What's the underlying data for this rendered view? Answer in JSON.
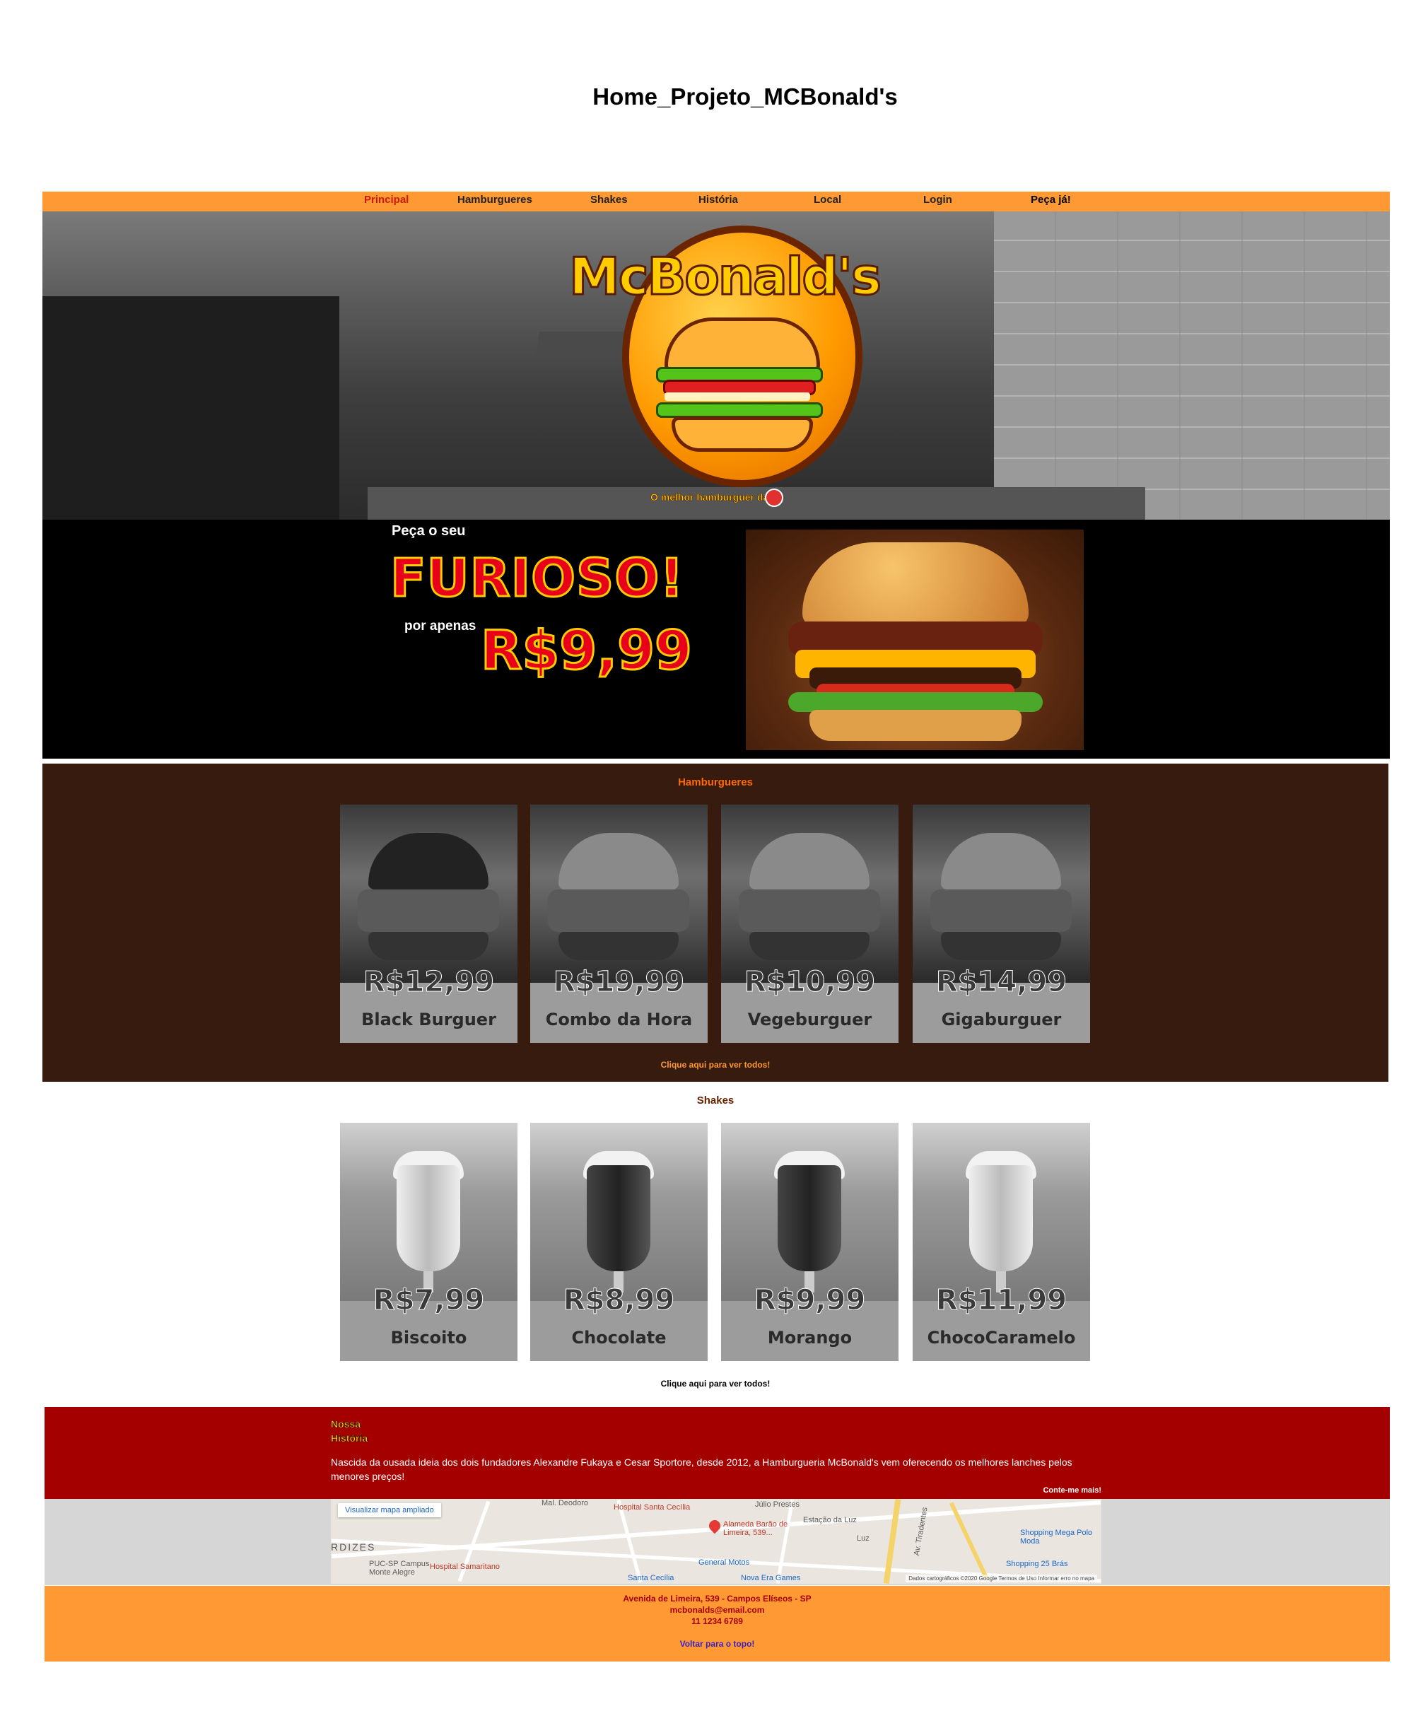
{
  "page": {
    "title": "Home_Projeto_MCBonald's"
  },
  "nav": {
    "items": [
      "Principal",
      "Hamburgueres",
      "Shakes",
      "História",
      "Local",
      "Login",
      "Peça já!"
    ],
    "active": "Principal"
  },
  "hero": {
    "logo_text": "McBonald's",
    "tagline": "O melhor hamburguer da"
  },
  "promo": {
    "intro": "Peça o seu",
    "name": "FURIOSO!",
    "sub": "por apenas",
    "price": "R$9,99"
  },
  "burgers": {
    "title": "Hamburgueres",
    "items": [
      {
        "price": "R$12,99",
        "name": "Black Burguer"
      },
      {
        "price": "R$19,99",
        "name": "Combo da Hora"
      },
      {
        "price": "R$10,99",
        "name": "Vegeburguer"
      },
      {
        "price": "R$14,99",
        "name": "Gigaburguer"
      }
    ],
    "see_all": "Clique aqui para ver todos!"
  },
  "shakes": {
    "title": "Shakes",
    "items": [
      {
        "price": "R$7,99",
        "name": "Biscoito"
      },
      {
        "price": "R$8,99",
        "name": "Chocolate"
      },
      {
        "price": "R$9,99",
        "name": "Morango"
      },
      {
        "price": "R$11,99",
        "name": "ChocoCaramelo"
      }
    ],
    "see_all": "Clique aqui para ver todos!"
  },
  "history": {
    "title_line1": "Nossa",
    "title_line2": "História",
    "text": "Nascida da ousada ideia dos dois fundadores Alexandre Fukaya e Cesar Sportore, desde 2012, a Hamburgueria McBonald's vem oferecendo os melhores lanches pelos menores preços!",
    "more": "Conte-me mais!"
  },
  "map": {
    "button": "Visualizar mapa ampliado",
    "place": "Alameda Barão de Limeira, 539...",
    "labels": [
      "Mal. Deodoro",
      "Hospital Santa Cecília",
      "Júlio Prestes",
      "Estação da Luz",
      "Luz",
      "Shopping Mega Polo Moda",
      "Shopping 25 Brás",
      "Hospital Samaritano",
      "PUC-SP Campus Monte Alegre",
      "General Motos",
      "Nova Era Games",
      "Santa Cecília",
      "RDIZES",
      "Av. Tiradentes"
    ],
    "credit": "Dados cartográficos ©2020 Google   Termos de Uso   Informar erro no mapa"
  },
  "footer": {
    "address": "Avenida de Limeira, 539 - Campos Elíseos - SP",
    "email": "mcbonalds@email.com",
    "phone": "11 1234 6789",
    "back_to_top": "Voltar para o topo!"
  },
  "colors": {
    "nav_bg": "#ff9933",
    "burgers_bg": "#361b0e",
    "history_bg": "#a50000",
    "footer_bg": "#ff9933",
    "card_bg": "#9c9c9c"
  }
}
